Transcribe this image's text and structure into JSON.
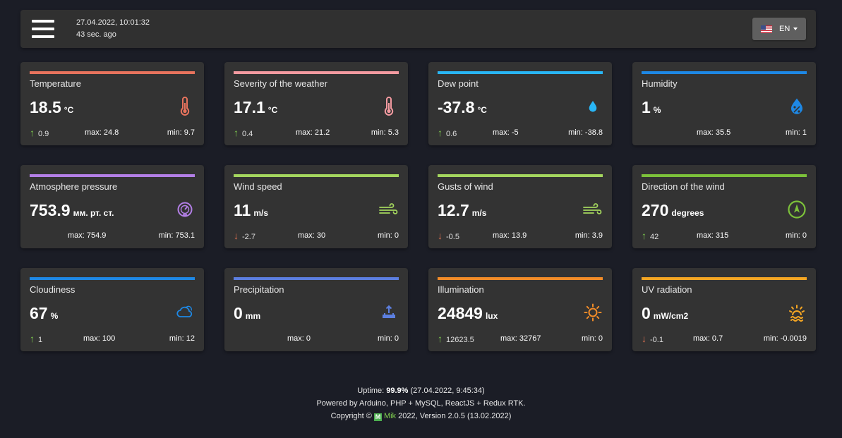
{
  "header": {
    "datetime": "27.04.2022, 10:01:32",
    "ago": "43 sec. ago",
    "lang": "EN"
  },
  "cards": [
    {
      "title": "Temperature",
      "value": "18.5",
      "unit": "°C",
      "icon": "thermometer-icon",
      "color": "#e8735d",
      "trend": "up",
      "trend_value": "0.9",
      "max": "max: 24.8",
      "min": "min: 9.7"
    },
    {
      "title": "Severity of the weather",
      "value": "17.1",
      "unit": "°C",
      "icon": "thermometer-icon",
      "color": "#f39aa0",
      "trend": "up",
      "trend_value": "0.4",
      "max": "max: 21.2",
      "min": "min: 5.3"
    },
    {
      "title": "Dew point",
      "value": "-37.8",
      "unit": "°C",
      "icon": "water-drop-icon",
      "color": "#29b6f6",
      "trend": "up",
      "trend_value": "0.6",
      "max": "max: -5",
      "min": "min: -38.8"
    },
    {
      "title": "Humidity",
      "value": "1",
      "unit": "%",
      "icon": "humidity-icon",
      "color": "#1e88e5",
      "trend": "",
      "trend_value": "",
      "max": "max: 35.5",
      "min": "min: 1"
    },
    {
      "title": "Atmosphere pressure",
      "value": "753.9",
      "unit": "мм. рт. ст.",
      "icon": "gauge-icon",
      "color": "#b37fe6",
      "trend": "",
      "trend_value": "",
      "max": "max: 754.9",
      "min": "min: 753.1"
    },
    {
      "title": "Wind speed",
      "value": "11",
      "unit": "m/s",
      "icon": "wind-icon",
      "color": "#a4d65e",
      "trend": "down",
      "trend_value": "-2.7",
      "max": "max: 30",
      "min": "min: 0"
    },
    {
      "title": "Gusts of wind",
      "value": "12.7",
      "unit": "m/s",
      "icon": "wind-icon",
      "color": "#a4d65e",
      "trend": "down",
      "trend_value": "-0.5",
      "max": "max: 13.9",
      "min": "min: 3.9"
    },
    {
      "title": "Direction of the wind",
      "value": "270",
      "unit": "degrees",
      "icon": "compass-icon",
      "color": "#7cc13a",
      "trend": "up",
      "trend_value": "42",
      "max": "max: 315",
      "min": "min: 0"
    },
    {
      "title": "Cloudiness",
      "value": "67",
      "unit": "%",
      "icon": "cloud-icon",
      "color": "#1e88e5",
      "trend": "up",
      "trend_value": "1",
      "max": "max: 100",
      "min": "min: 12"
    },
    {
      "title": "Precipitation",
      "value": "0",
      "unit": "mm",
      "icon": "precipitation-icon",
      "color": "#5c7fe0",
      "trend": "",
      "trend_value": "",
      "max": "max: 0",
      "min": "min: 0"
    },
    {
      "title": "Illumination",
      "value": "24849",
      "unit": "lux",
      "icon": "sun-icon",
      "color": "#f28c28",
      "trend": "up",
      "trend_value": "12623.5",
      "max": "max: 32767",
      "min": "min: 0"
    },
    {
      "title": "UV radiation",
      "value": "0",
      "unit": "mW/cm2",
      "icon": "uv-sun-icon",
      "color": "#f5a623",
      "trend": "down",
      "trend_value": "-0.1",
      "max": "max: 0.7",
      "min": "min: -0.0019"
    }
  ],
  "footer": {
    "uptime_label": "Uptime:",
    "uptime_value": "99.9%",
    "uptime_since": "(27.04.2022, 9:45:34)",
    "powered": "Powered by Arduino, PHP + MySQL, ReactJS + Redux RTK.",
    "copyright_prefix": "Copyright ©",
    "mik": "Mik",
    "copyright_suffix": "2022, Version 2.0.5 (13.02.2022)"
  }
}
